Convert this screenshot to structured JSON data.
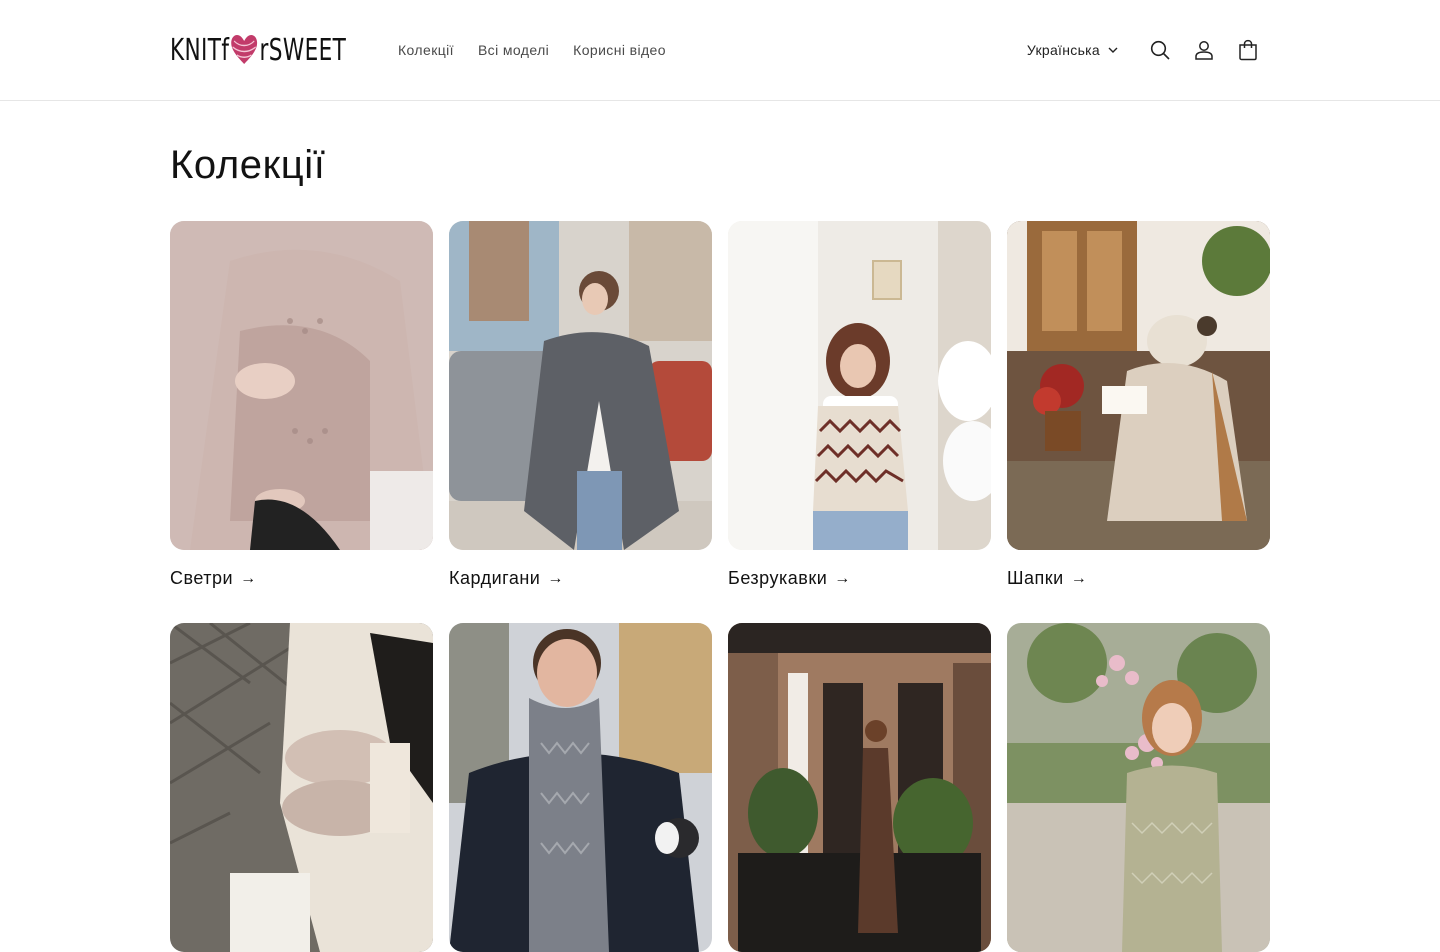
{
  "brand": {
    "logo_left": "KNIT",
    "logo_mid": "f",
    "logo_mid2": "r",
    "logo_right": "SWEET"
  },
  "nav": [
    {
      "label": "Колекції"
    },
    {
      "label": "Всі моделі"
    },
    {
      "label": "Корисні відео"
    }
  ],
  "header": {
    "language": "Українська"
  },
  "icons": {
    "search": "search-icon",
    "account": "account-icon",
    "cart": "cart-icon"
  },
  "page": {
    "title": "Колекції"
  },
  "collections": [
    {
      "label": "Светри",
      "arrow": "→",
      "bg": "#c9b4ae",
      "accent": "#e9dcd6"
    },
    {
      "label": "Кардигани",
      "arrow": "→",
      "bg": "#a9a6a3",
      "accent": "#6a6a6c"
    },
    {
      "label": "Безрукавки",
      "arrow": "→",
      "bg": "#ece8e2",
      "accent": "#7a3a34"
    },
    {
      "label": "Шапки",
      "arrow": "→",
      "bg": "#8c6a4a",
      "accent": "#e6ded2"
    },
    {
      "label": "",
      "bg": "#6f6c66",
      "accent": "#d9c9c0"
    },
    {
      "label": "",
      "bg": "#c9ccd2",
      "accent": "#7d8087"
    },
    {
      "label": "",
      "bg": "#5d4f46",
      "accent": "#5a3a2c"
    },
    {
      "label": "",
      "bg": "#b9bfa8",
      "accent": "#a9ad92"
    }
  ]
}
